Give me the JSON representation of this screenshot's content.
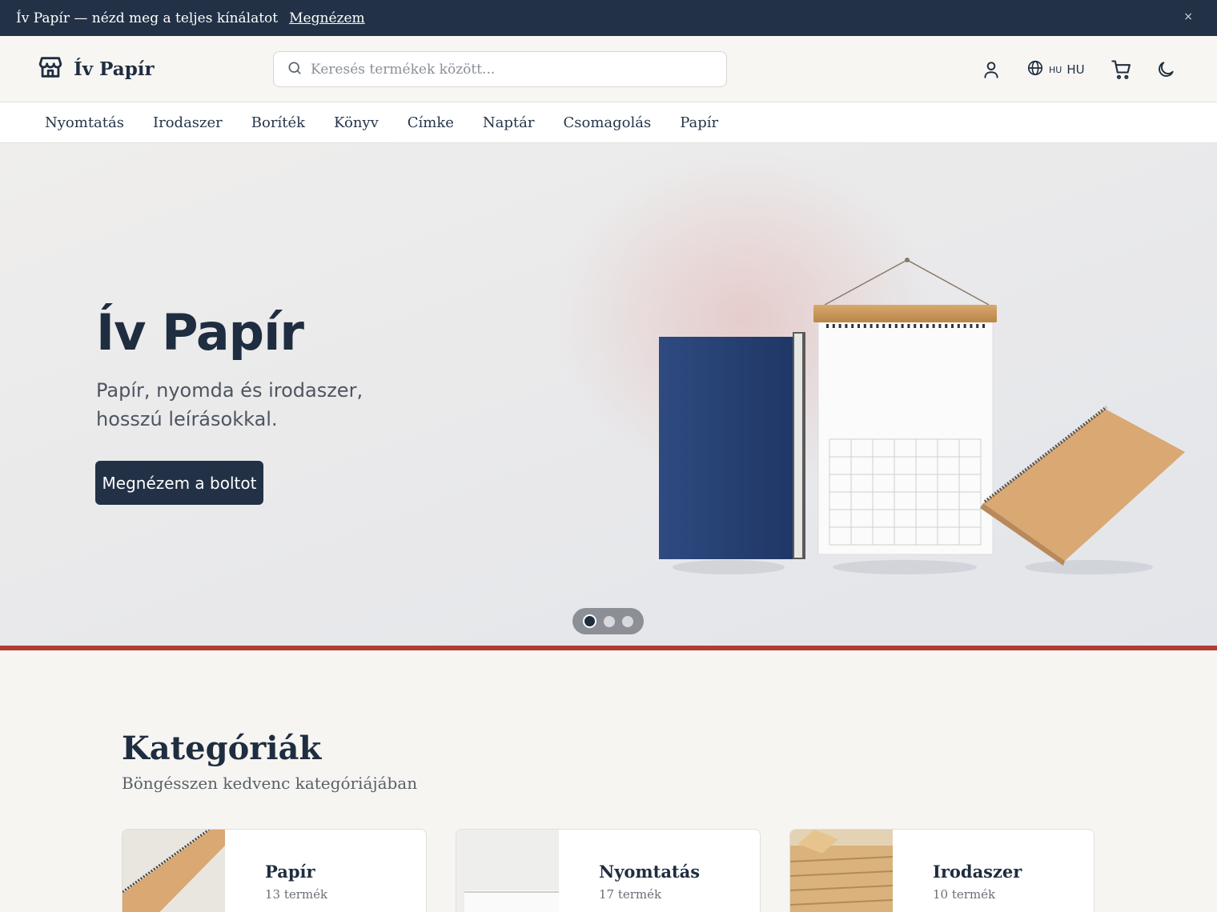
{
  "announcement": {
    "message": "Ív Papír — nézd meg a teljes kínálatot",
    "link": "Megnézem",
    "close": "×"
  },
  "header": {
    "brand": "Ív Papír",
    "search_placeholder": "Keresés termékek között...",
    "language_code": "HU",
    "language": "HU",
    "icons": [
      "store-icon",
      "search-icon",
      "user-icon",
      "globe-icon",
      "cart-icon",
      "moon-icon"
    ]
  },
  "nav": {
    "items": [
      "Nyomtatás",
      "Irodaszer",
      "Boríték",
      "Könyv",
      "Címke",
      "Naptár",
      "Csomagolás",
      "Papír"
    ]
  },
  "hero": {
    "title": "Ív Papír",
    "subtitle": "Papír, nyomda és irodaszer, hosszú leírásokkal.",
    "cta": "Megnézem a boltot",
    "slides": 3,
    "active_slide": 1,
    "accent_color": "#b23b32"
  },
  "categories": {
    "title": "Kategóriák",
    "subtitle": "Böngésszen kedvenc kategóriájában",
    "items": [
      {
        "name": "Papír",
        "count": "13 termék"
      },
      {
        "name": "Nyomtatás",
        "count": "17 termék"
      },
      {
        "name": "Irodaszer",
        "count": "10 termék"
      }
    ]
  },
  "colors": {
    "primary": "#223146",
    "background": "#f6f5f2",
    "accent": "#b23b32"
  }
}
